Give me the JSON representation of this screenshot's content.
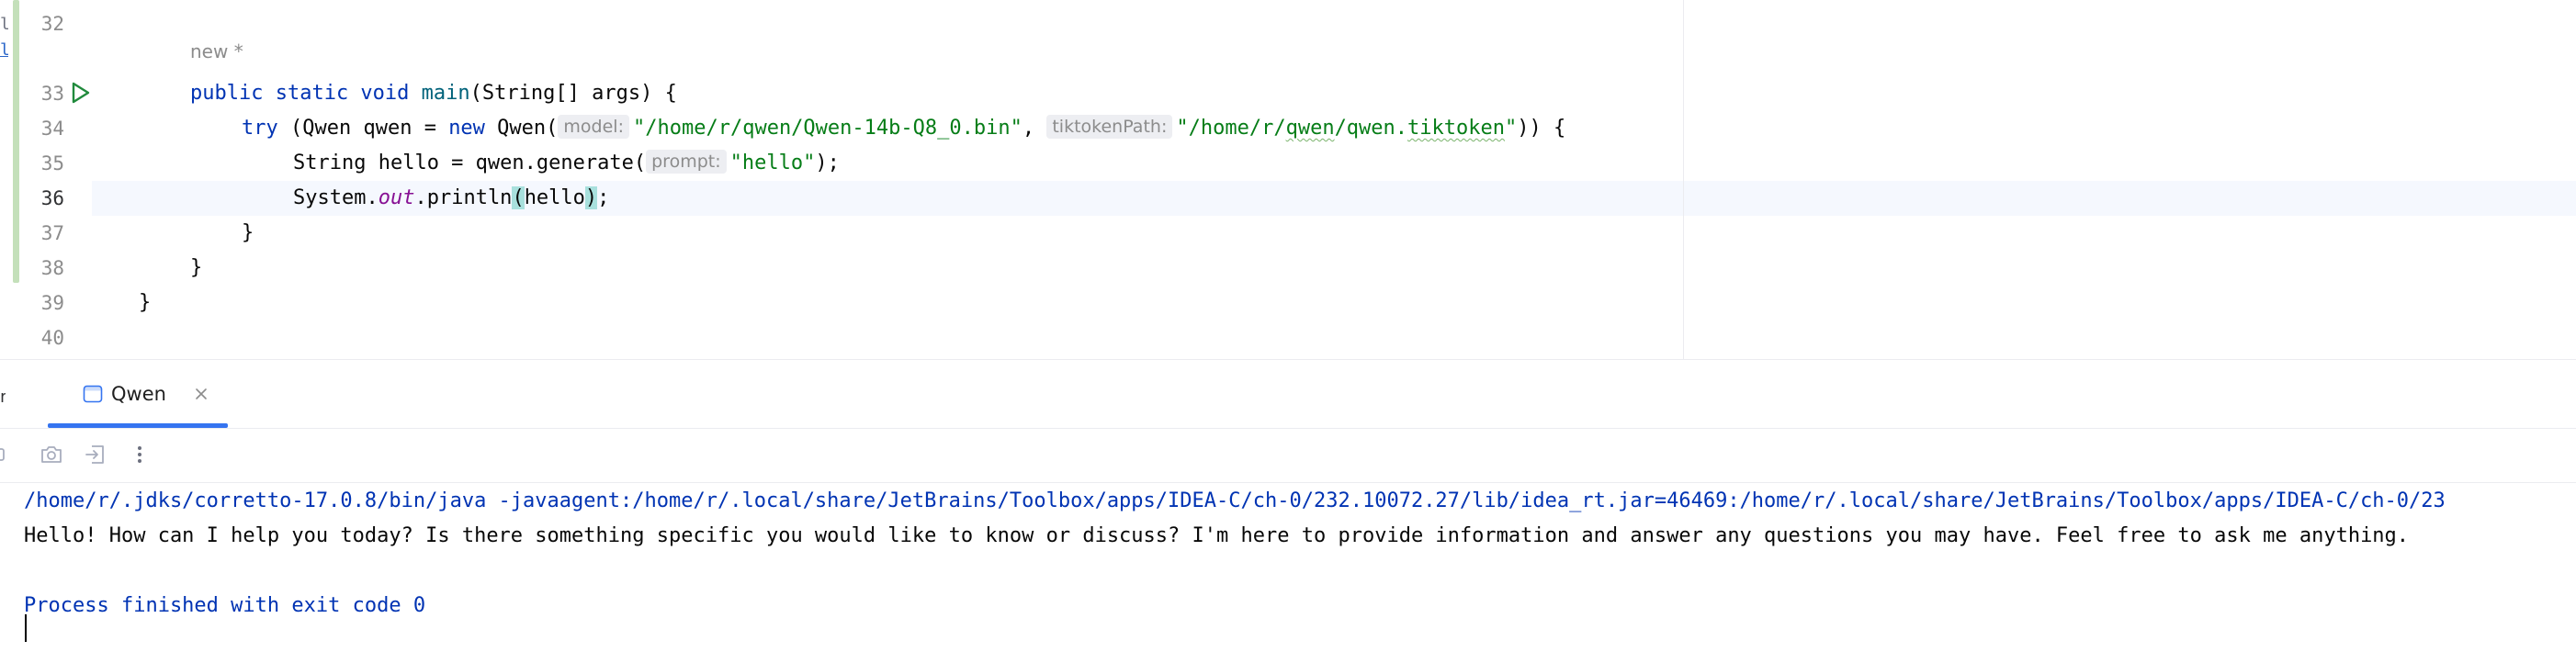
{
  "editor": {
    "author_hint": "new *",
    "line_numbers": [
      "32",
      "33",
      "34",
      "35",
      "36",
      "37",
      "38",
      "39",
      "40"
    ],
    "line33": {
      "kw": "public static void",
      "fn": "main",
      "rest": "(String[] args) {"
    },
    "line34": {
      "try": "try",
      "open": " (Qwen qwen = ",
      "new": "new",
      "ctor": " Qwen(",
      "hint_model": "model:",
      "model_path": "\"/home/r/qwen/Qwen-14b-Q8_0.bin\"",
      "comma": ", ",
      "hint_tiktoken": "tiktokenPath:",
      "tiktoken_path_a": "\"/home/r/",
      "tiktoken_path_b": "qwen",
      "tiktoken_path_c": "/qwen.",
      "tiktoken_path_d": "tiktoken",
      "tiktoken_path_e": "\"",
      "close": ")) {"
    },
    "line35": {
      "start": "String hello = qwen.generate(",
      "hint_prompt": "prompt:",
      "arg": "\"hello\"",
      "end": ");"
    },
    "line36": {
      "start": "System.",
      "field": "out",
      "mid": ".println",
      "paren_open": "(",
      "arg": "hello",
      "paren_close": ")",
      "end": ";"
    },
    "line37": "}",
    "line38": "}",
    "line39": "}",
    "left_glyph_1": "lt",
    "left_glyph_2": "le"
  },
  "tool_window": {
    "left_edge_label": "n",
    "tab": {
      "label": "Qwen",
      "icon": "console-window-icon",
      "close_icon": "close-icon"
    },
    "toolbar": {
      "icons": [
        "stop-icon",
        "camera-icon",
        "exit-icon",
        "more-vertical-icon"
      ]
    },
    "console": {
      "command_line": "/home/r/.jdks/corretto-17.0.8/bin/java -javaagent:/home/r/.local/share/JetBrains/Toolbox/apps/IDEA-C/ch-0/232.10072.27/lib/idea_rt.jar=46469:/home/r/.local/share/JetBrains/Toolbox/apps/IDEA-C/ch-0/23",
      "output_line": "Hello! How can I help you today? Is there something specific you would like to know or discuss? I'm here to provide information and answer any questions you may have. Feel free to ask me anything.",
      "exit_line": "Process finished with exit code 0"
    }
  },
  "colors": {
    "keyword": "#0033b3",
    "string": "#067d17",
    "function": "#00627a",
    "field": "#871094",
    "accent": "#3574f0",
    "change_bar": "#c4e0ba"
  }
}
